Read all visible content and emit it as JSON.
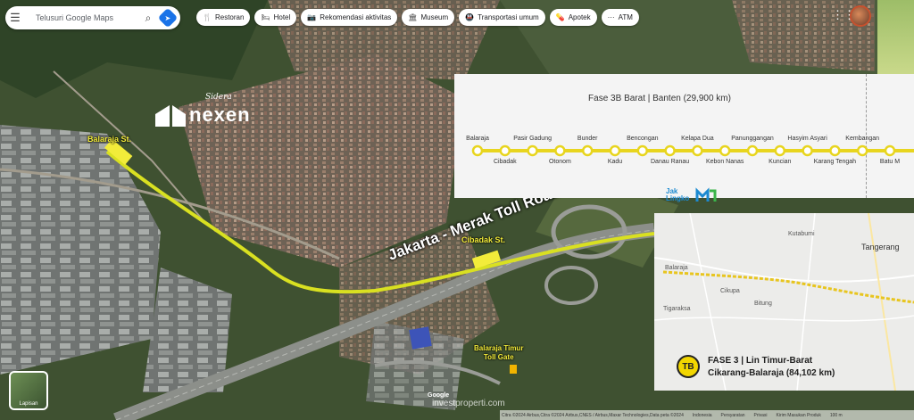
{
  "search": {
    "placeholder": "Telusuri Google Maps"
  },
  "chips": [
    {
      "icon": "restaurant-icon",
      "glyph": "🍴",
      "label": "Restoran"
    },
    {
      "icon": "hotel-icon",
      "glyph": "🛏",
      "label": "Hotel"
    },
    {
      "icon": "camera-icon",
      "glyph": "📷",
      "label": "Rekomendasi aktivitas"
    },
    {
      "icon": "museum-icon",
      "glyph": "🏛",
      "label": "Museum"
    },
    {
      "icon": "transit-icon",
      "glyph": "🚇",
      "label": "Transportasi umum"
    },
    {
      "icon": "pharmacy-icon",
      "glyph": "💊",
      "label": "Apotek"
    },
    {
      "icon": "atm-icon",
      "glyph": "⋯",
      "label": "ATM"
    }
  ],
  "logo": {
    "sidera": "Sidera",
    "name": "nexen"
  },
  "map_labels": {
    "balaraja_st": "Balaraja St.",
    "cibadak_st": "Cibadak St.",
    "toll_road": "Jakarta - Merak Toll Road",
    "toll_gate_line1": "Balaraja Timur",
    "toll_gate_line2": "Toll Gate"
  },
  "phase3b": {
    "title": "Fase 3B Barat | Banten (29,900 km)",
    "stations_top": [
      "Balaraja",
      "Pasir Gadung",
      "Bunder",
      "Bencongan",
      "Kelapa Dua",
      "Panunggangan",
      "Hasyim Asyari",
      "Kembangan"
    ],
    "stations_bottom": [
      "Cibadak",
      "Otonom",
      "Kadu",
      "Danau Ranau",
      "Kebon Nanas",
      "Kuncian",
      "Karang Tengah",
      "Batu M"
    ],
    "line_color": "#e8d51e"
  },
  "brands": {
    "jak_line1": "Jak",
    "jak_line2": "Lingko",
    "mrt": "mrt jakarta"
  },
  "inset": {
    "places": [
      "Kutabumi",
      "Tangerang",
      "Balaraja",
      "Bitung",
      "Tigaraksa",
      "Cikupa"
    ],
    "badge": "TB",
    "phase_line1": "FASE 3 | Lin Timur-Barat",
    "phase_line2": "Cikarang-Balaraja (84,102 km)"
  },
  "layers_label": "Lapisan",
  "watermark": "investproperti.com",
  "google_label": "Google",
  "attribution": [
    "Citra ©2024 Airbus,Citra ©2024 Airbus,CNES / Airbus,Maxar Technologies,Data peta ©2024",
    "Indonesia",
    "Persyaratan",
    "Privasi",
    "Kirim Masukan Produk",
    "100 m"
  ],
  "colors": {
    "route": "#d9e021",
    "station": "#f2ec3a",
    "panel_bg": "#f4f4f4"
  }
}
